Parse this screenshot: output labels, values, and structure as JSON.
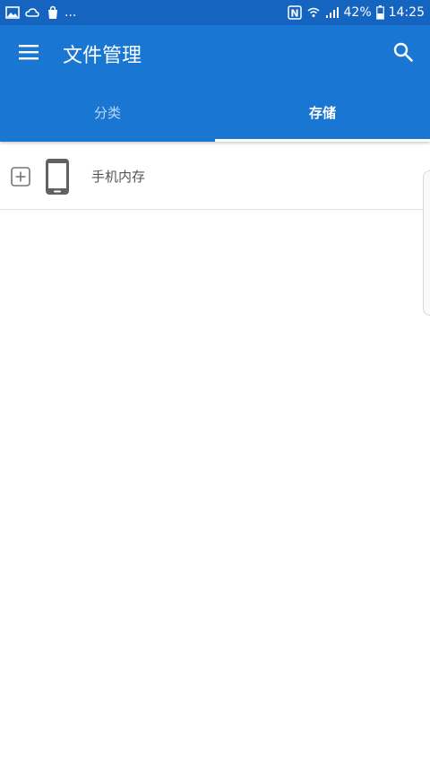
{
  "status_bar": {
    "notification_icons": [
      "gallery-icon",
      "weather-icon",
      "bag-icon"
    ],
    "more": "...",
    "nfc": "N",
    "battery": "42%",
    "time": "14:25"
  },
  "app_bar": {
    "title": "文件管理",
    "menu_icon": "menu-icon",
    "search_icon": "search-icon"
  },
  "tabs": [
    {
      "label": "分类",
      "active": false
    },
    {
      "label": "存储",
      "active": true
    }
  ],
  "storage_list": [
    {
      "label": "手机内存",
      "icon": "phone-icon",
      "expand_icon": "plus-square-icon"
    }
  ],
  "colors": {
    "status_bar": "#1565c0",
    "app_bar": "#1976d2",
    "tab_active": "#ffffff",
    "tab_inactive": "#bcd7f5"
  }
}
